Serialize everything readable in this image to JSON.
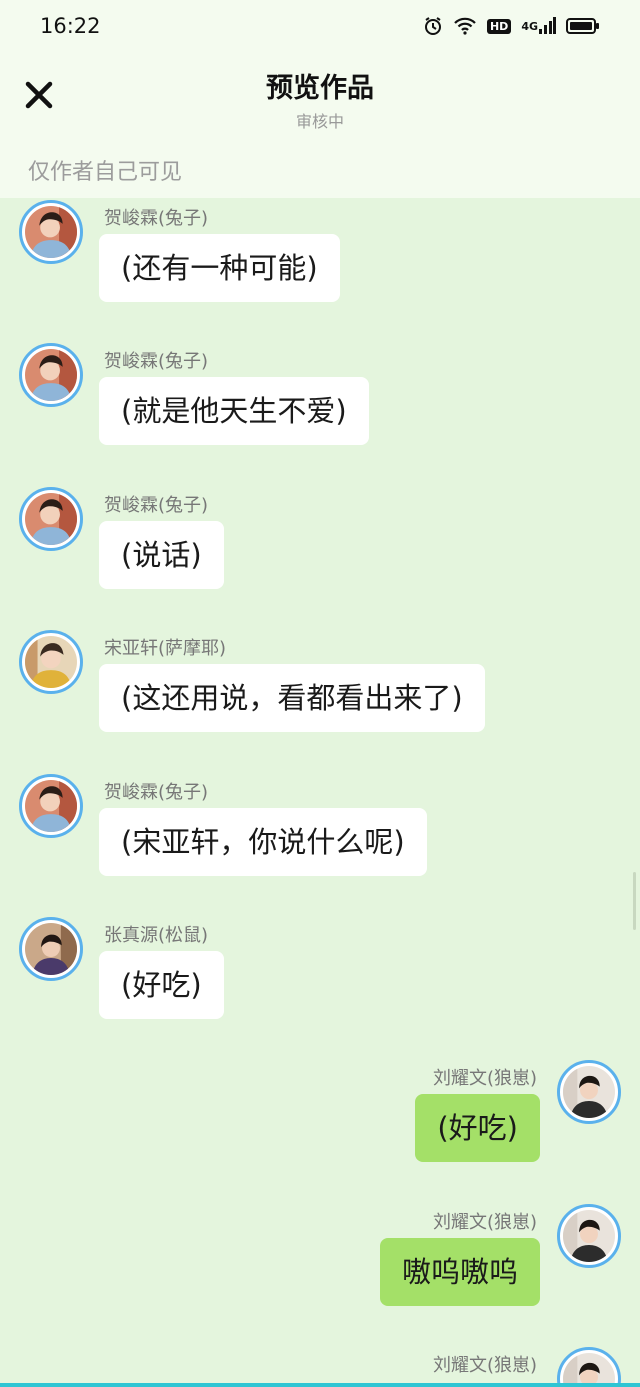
{
  "status": {
    "time": "16:22",
    "hd": "HD",
    "network": "4G"
  },
  "header": {
    "title": "预览作品",
    "subtitle": "审核中",
    "visibility": "仅作者自己可见"
  },
  "messages": [
    {
      "side": "left",
      "avatar": "boy-blue",
      "name": "贺峻霖(兔子)",
      "text": "(还有一种可能)"
    },
    {
      "side": "left",
      "avatar": "boy-blue",
      "name": "贺峻霖(兔子)",
      "text": "(就是他天生不爱)"
    },
    {
      "side": "left",
      "avatar": "boy-blue",
      "name": "贺峻霖(兔子)",
      "text": "(说话)"
    },
    {
      "side": "left",
      "avatar": "boy-yellow",
      "name": "宋亚轩(萨摩耶)",
      "text": "(这还用说，看都看出来了)"
    },
    {
      "side": "left",
      "avatar": "boy-blue",
      "name": "贺峻霖(兔子)",
      "text": "(宋亚轩，你说什么呢)"
    },
    {
      "side": "left",
      "avatar": "boy-brown",
      "name": "张真源(松鼠)",
      "text": "(好吃)"
    },
    {
      "side": "right",
      "avatar": "boy-light",
      "name": "刘耀文(狼崽)",
      "text": "(好吃)"
    },
    {
      "side": "right",
      "avatar": "boy-light",
      "name": "刘耀文(狼崽)",
      "text": "嗷呜嗷呜"
    },
    {
      "side": "right",
      "avatar": "boy-light",
      "name": "刘耀文(狼崽)",
      "text": ""
    }
  ],
  "colors": {
    "background": "#e4f5dd",
    "header": "#f4fbef",
    "left_bubble": "#ffffff",
    "right_bubble": "#a4e068",
    "avatar_ring": "#5ab1ec"
  }
}
